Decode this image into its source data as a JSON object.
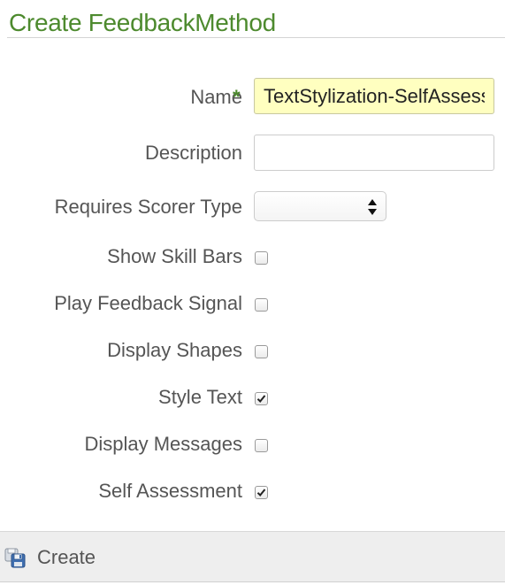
{
  "page": {
    "title": "Create FeedbackMethod"
  },
  "form": {
    "name": {
      "label": "Name",
      "required_marker": "*",
      "value": "TextStylization-SelfAssessment"
    },
    "description": {
      "label": "Description",
      "value": ""
    },
    "requires_scorer_type": {
      "label": "Requires Scorer Type",
      "selected": ""
    },
    "checkboxes": [
      {
        "label": "Show Skill Bars",
        "checked": false
      },
      {
        "label": "Play Feedback Signal",
        "checked": false
      },
      {
        "label": "Display Shapes",
        "checked": false
      },
      {
        "label": "Style Text",
        "checked": true
      },
      {
        "label": "Display Messages",
        "checked": false
      },
      {
        "label": "Self Assessment",
        "checked": true
      }
    ]
  },
  "footer": {
    "create_label": "Create",
    "create_icon": "save-icon"
  },
  "colors": {
    "accent_green": "#4d8a2e",
    "name_input_bg": "#ffffc0"
  }
}
